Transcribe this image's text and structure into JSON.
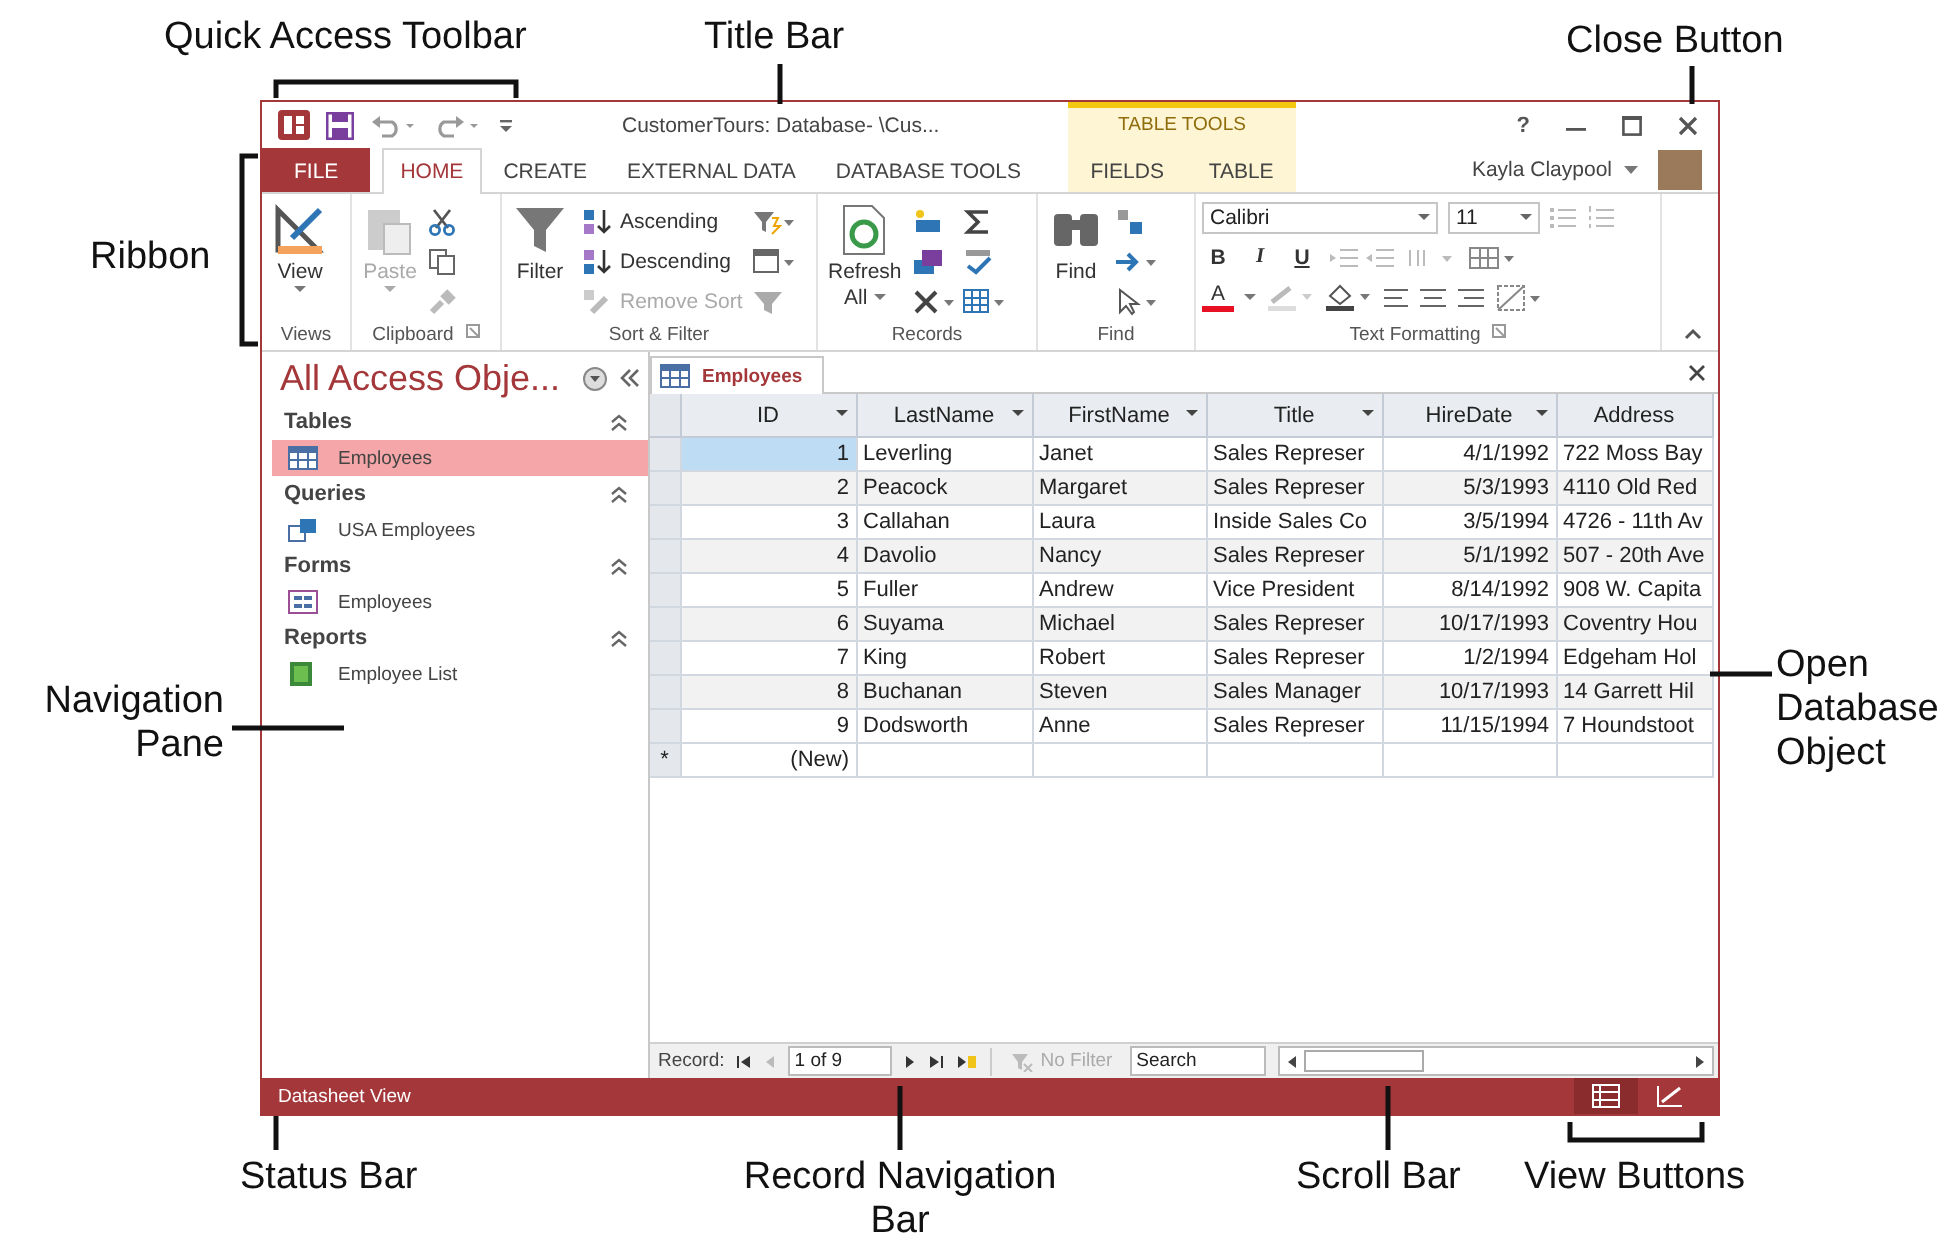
{
  "callouts": [
    {
      "text": "Quick Access Toolbar"
    },
    {
      "text": "Title Bar"
    },
    {
      "text": "Close Button"
    },
    {
      "text": "Ribbon"
    },
    {
      "text": "Navigation Pane"
    },
    {
      "text": "Open Database Object"
    },
    {
      "text": "Status Bar"
    },
    {
      "text": "Record Navigation Bar"
    },
    {
      "text": "Scroll Bar"
    },
    {
      "text": "View Buttons"
    }
  ],
  "window": {
    "title": "CustomerTours: Database- \\Cus...",
    "context_group": "TABLE TOOLS",
    "help": "?",
    "user": "Kayla Claypool"
  },
  "tabs": [
    {
      "label": "FILE",
      "kind": "file",
      "selected": false
    },
    {
      "label": "HOME",
      "kind": "main",
      "selected": true
    },
    {
      "label": "CREATE",
      "kind": "main",
      "selected": false
    },
    {
      "label": "EXTERNAL DATA",
      "kind": "main",
      "selected": false
    },
    {
      "label": "DATABASE TOOLS",
      "kind": "main",
      "selected": false
    },
    {
      "label": "FIELDS",
      "kind": "context",
      "selected": false
    },
    {
      "label": "TABLE",
      "kind": "context",
      "selected": false
    }
  ],
  "ribbon": {
    "views": {
      "label": "Views",
      "view": "View"
    },
    "clipboard": {
      "label": "Clipboard",
      "paste": {
        "label": "Paste",
        "disabled": true
      }
    },
    "sort_filter": {
      "label": "Sort & Filter",
      "filter": "Filter",
      "ascending": "Ascending",
      "descending": "Descending",
      "remove_sort": {
        "label": "Remove Sort",
        "disabled": true
      }
    },
    "records": {
      "label": "Records",
      "refresh": "Refresh",
      "refresh_all": "All"
    },
    "find": {
      "label": "Find",
      "find": "Find"
    },
    "text_formatting": {
      "label": "Text Formatting",
      "font": "Calibri",
      "size": "11",
      "bold": "B",
      "italic": "I",
      "underline": "U",
      "font_color": "A"
    }
  },
  "nav": {
    "title": "All Access Obje...",
    "groups": [
      {
        "name": "Tables",
        "kind": "table",
        "items": [
          {
            "label": "Employees",
            "selected": true
          }
        ]
      },
      {
        "name": "Queries",
        "kind": "query",
        "items": [
          {
            "label": "USA Employees",
            "selected": false
          }
        ]
      },
      {
        "name": "Forms",
        "kind": "form",
        "items": [
          {
            "label": "Employees",
            "selected": false
          }
        ]
      },
      {
        "name": "Reports",
        "kind": "report",
        "items": [
          {
            "label": "Employee List",
            "selected": false
          }
        ]
      }
    ]
  },
  "document": {
    "tab": "Employees",
    "columns": [
      {
        "label": "ID",
        "kind": "number",
        "dropdown": true
      },
      {
        "label": "LastName",
        "kind": "text",
        "dropdown": true
      },
      {
        "label": "FirstName",
        "kind": "text",
        "dropdown": true
      },
      {
        "label": "Title",
        "kind": "text",
        "dropdown": true
      },
      {
        "label": "HireDate",
        "kind": "number",
        "dropdown": true
      },
      {
        "label": "Address",
        "kind": "text",
        "dropdown": false
      }
    ],
    "rows": [
      {
        "selected": true,
        "cells": [
          "1",
          "Leverling",
          "Janet",
          "Sales Represer",
          "4/1/1992",
          "722 Moss Bay"
        ]
      },
      {
        "selected": false,
        "cells": [
          "2",
          "Peacock",
          "Margaret",
          "Sales Represer",
          "5/3/1993",
          "4110 Old Red"
        ]
      },
      {
        "selected": false,
        "cells": [
          "3",
          "Callahan",
          "Laura",
          "Inside Sales Co",
          "3/5/1994",
          "4726 - 11th Av"
        ]
      },
      {
        "selected": false,
        "cells": [
          "4",
          "Davolio",
          "Nancy",
          "Sales Represer",
          "5/1/1992",
          "507 - 20th Ave"
        ]
      },
      {
        "selected": false,
        "cells": [
          "5",
          "Fuller",
          "Andrew",
          "Vice President",
          "8/14/1992",
          "908 W. Capita"
        ]
      },
      {
        "selected": false,
        "cells": [
          "6",
          "Suyama",
          "Michael",
          "Sales Represer",
          "10/17/1993",
          "Coventry Hou"
        ]
      },
      {
        "selected": false,
        "cells": [
          "7",
          "King",
          "Robert",
          "Sales Represer",
          "1/2/1994",
          "Edgeham Hol"
        ]
      },
      {
        "selected": false,
        "cells": [
          "8",
          "Buchanan",
          "Steven",
          "Sales Manager",
          "10/17/1993",
          "14 Garrett Hil"
        ]
      },
      {
        "selected": false,
        "cells": [
          "9",
          "Dodsworth",
          "Anne",
          "Sales Represer",
          "11/15/1994",
          "7 Houndstoot"
        ]
      }
    ],
    "new_row": {
      "marker": "*",
      "id": "(New)"
    }
  },
  "record_nav": {
    "label": "Record:",
    "position": "1 of 9",
    "filter": "No Filter",
    "search_placeholder": "Search"
  },
  "status": {
    "text": "Datasheet View",
    "views": [
      {
        "kind": "datasheet",
        "selected": true
      },
      {
        "kind": "design",
        "selected": false
      }
    ]
  }
}
